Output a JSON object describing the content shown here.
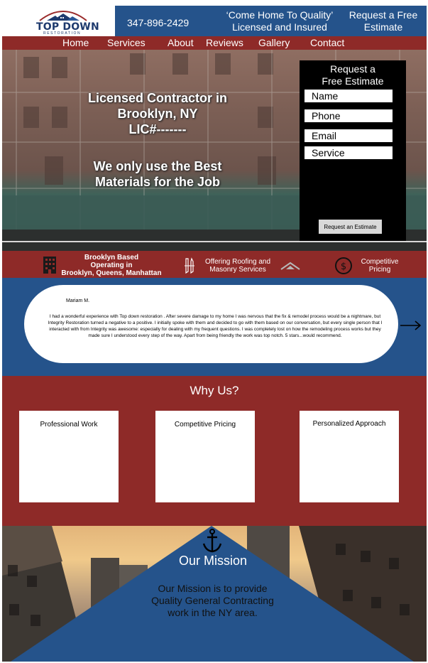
{
  "brand": {
    "name": "TOP DOWN",
    "sub": "RESTORATION"
  },
  "header": {
    "phone": "347-896-2429",
    "tagline_1": "‘Come Home To Quality’",
    "tagline_2": "Licensed and Insured",
    "cta_1": "Request a Free",
    "cta_2": "Estimate"
  },
  "nav": {
    "items": [
      "Home",
      "Services",
      "About",
      "Reviews",
      "Gallery",
      "Contact"
    ]
  },
  "hero": {
    "title_1": "Licensed Contractor in",
    "title_2": "Brooklyn, NY",
    "title_3": "LIC#-------",
    "sub_1": "We only use the Best",
    "sub_2": "Materials for the Job"
  },
  "form": {
    "title_1": "Request a",
    "title_2": "Free Estimate",
    "name_placeholder": "Name",
    "phone_placeholder": "Phone",
    "email_placeholder": "Email",
    "service_placeholder": "Service",
    "submit_label": "Request an Estimate"
  },
  "features": [
    {
      "icon": "building-icon",
      "lines": [
        "Brooklyn Based",
        "Operating in",
        "Brooklyn, Queens, Manhattan"
      ]
    },
    {
      "icon": "tools-icon",
      "lines": [
        "Offering Roofing and",
        "Masonry Services"
      ]
    },
    {
      "icon": "dollar-icon",
      "lines": [
        "Competitive",
        "Pricing"
      ]
    }
  ],
  "review": {
    "author": "Mariam M.",
    "text": "I had a wonderful experience with Top down restoration . After severe damage to my home I was nervous that the fix & remodel process would be a nightmare, but Integrity Restoration turned a negative to a positive. I initially spoke with them and decided to go with them based on our conversation, but every single person that I interacted with from Integrity was awesome: especially for dealing with my frequent questions. I was completely lost on how the remodeling process works but they made sure I understood every step of the way. Apart from being friendly the work was top notch. 5 stars...would recommend."
  },
  "why": {
    "title": "Why Us?",
    "cards": [
      "Professional Work",
      "Competitive Pricing",
      "Personalized Approach"
    ]
  },
  "mission": {
    "title": "Our Mission",
    "line_1": "Our Mission is to provide",
    "line_2": "Quality General Contracting",
    "line_3": "work in the NY area."
  },
  "colors": {
    "brand_blue": "#25538b",
    "brand_red": "#8e2a28",
    "form_black": "#000000"
  }
}
